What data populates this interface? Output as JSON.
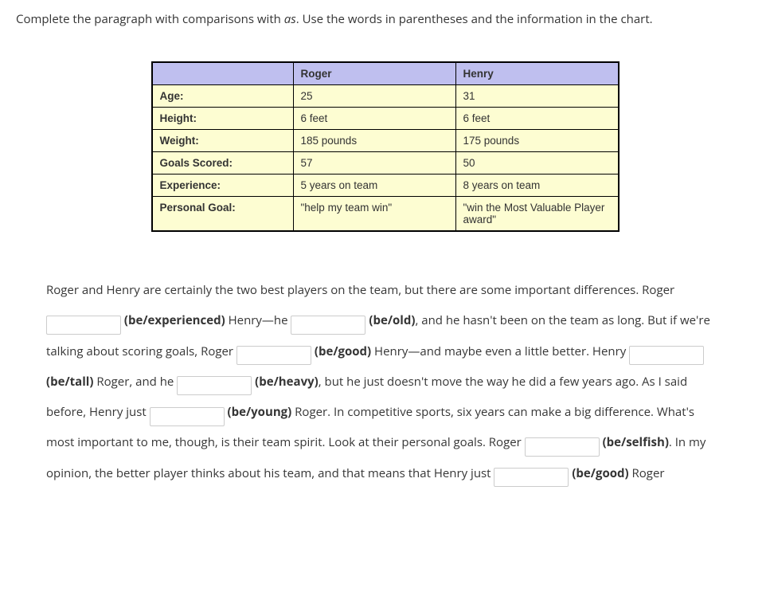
{
  "instruction": {
    "pre": "Complete the paragraph with comparisons with ",
    "italic": "as",
    "post": ". Use the words in parentheses and the information in the chart."
  },
  "chart_data": {
    "type": "table",
    "columns": [
      "",
      "Roger",
      "Henry"
    ],
    "rows": [
      {
        "label": "Age:",
        "roger": "25",
        "henry": "31"
      },
      {
        "label": "Height:",
        "roger": "6 feet",
        "henry": "6 feet"
      },
      {
        "label": "Weight:",
        "roger": "185 pounds",
        "henry": "175 pounds"
      },
      {
        "label": "Goals Scored:",
        "roger": "57",
        "henry": "50"
      },
      {
        "label": "Experience:",
        "roger": "5 years on team",
        "henry": "8 years on team"
      },
      {
        "label": "Personal Goal:",
        "roger": "\"help my team win\"",
        "henry": "\"win the Most Valuable Player award\""
      }
    ]
  },
  "paragraph": {
    "t0": "Roger and Henry are certainly the two best players on the team, but there are some important differences. Roger ",
    "b1": "(be/experienced)",
    "t1": " Henry—he ",
    "b2": "(be/old)",
    "t2": ", and he hasn't been on the team as long. But if we're talking about scoring goals, Roger ",
    "b3": "(be/good)",
    "t3": " Henry—and maybe even a little better. Henry ",
    "b4": "(be/tall)",
    "t4": " Roger, and he ",
    "b5": "(be/heavy)",
    "t5": ", but he just doesn't move the way he did a few years ago. As I said before, Henry just ",
    "b6": "(be/young)",
    "t6": " Roger. In competitive sports, six years can make a big difference. What's most important to me, though, is their team spirit. Look at their personal goals. Roger ",
    "b7": "(be/selfish)",
    "t7": ". In my opinion, the better player thinks about his team, and that means that Henry just ",
    "b8": "(be/good)",
    "t8": " Roger"
  }
}
